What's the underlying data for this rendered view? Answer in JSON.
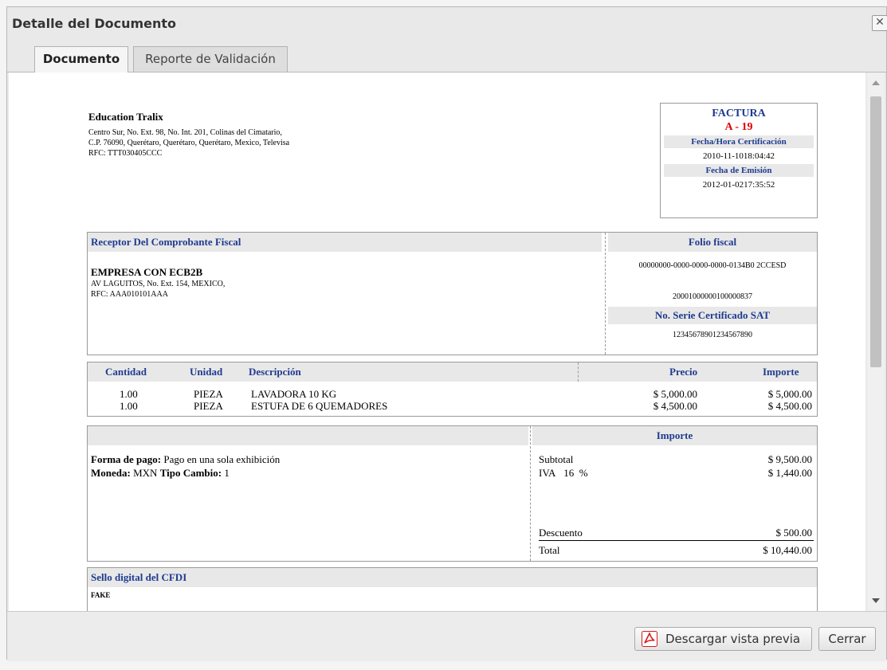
{
  "dialog": {
    "title": "Detalle del Documento",
    "close_glyph": "✕"
  },
  "tabs": [
    {
      "label": "Documento",
      "active": true
    },
    {
      "label": "Reporte de Validación",
      "active": false
    }
  ],
  "issuer": {
    "name": "Education Tralix",
    "address1": "Centro Sur, No. Ext. 98, No. Int. 201, Colinas del Cimatario,",
    "address2": "C.P. 76090, Querétaro, Querétaro, Querétaro, Mexico, Televisa",
    "rfc": "RFC: TTT030405CCC"
  },
  "invoice": {
    "type": "FACTURA",
    "folio": "A - 19",
    "cert_label": "Fecha/Hora Certificación",
    "cert_value": "2010-11-1018:04:42",
    "emission_label": "Fecha de Emisión",
    "emission_value": "2012-01-0217:35:52"
  },
  "receptor": {
    "header": "Receptor Del Comprobante Fiscal",
    "name": "EMPRESA CON ECB2B",
    "address": "AV LAGUITOS, No. Ext. 154, MEXICO,",
    "rfc": "RFC: AAA010101AAA"
  },
  "fiscal": {
    "folio_label": "Folio fiscal",
    "folio_value": "00000000-0000-0000-0000-0134B0 2CCESD",
    "cert_number": "20001000000100000837",
    "serie_label": "No. Serie Certificado SAT",
    "serie_value": "12345678901234567890"
  },
  "items": {
    "headers": {
      "cantidad": "Cantidad",
      "unidad": "Unidad",
      "descripcion": "Descripción",
      "precio": "Precio",
      "importe": "Importe"
    },
    "rows": [
      {
        "cantidad": "1.00",
        "unidad": "PIEZA",
        "descripcion": "LAVADORA 10 KG",
        "precio": "$ 5,000.00",
        "importe": "$ 5,000.00"
      },
      {
        "cantidad": "1.00",
        "unidad": "PIEZA",
        "descripcion": "ESTUFA DE 6 QUEMADORES",
        "precio": "$ 4,500.00",
        "importe": "$ 4,500.00"
      }
    ]
  },
  "payment": {
    "forma_label": "Forma de pago:",
    "forma_value": "Pago en una sola exhibición",
    "moneda_label": "Moneda:",
    "moneda_value": "MXN",
    "cambio_label": "Tipo Cambio:",
    "cambio_value": "1"
  },
  "totals": {
    "header": "Importe",
    "subtotal_label": "Subtotal",
    "subtotal_value": "$ 9,500.00",
    "iva_label": "IVA",
    "iva_rate": "16",
    "iva_pct": "%",
    "iva_value": "$ 1,440.00",
    "descuento_label": "Descuento",
    "descuento_value": "$ 500.00",
    "total_label": "Total",
    "total_value": "$ 10,440.00"
  },
  "sello": {
    "header": "Sello digital del CFDI",
    "value": "FAKE"
  },
  "footer": {
    "download_label": "Descargar vista previa",
    "close_label": "Cerrar"
  },
  "colors": {
    "accent_blue": "#1f3b8f",
    "folio_red": "#e00000",
    "pdf_red": "#d42020"
  }
}
